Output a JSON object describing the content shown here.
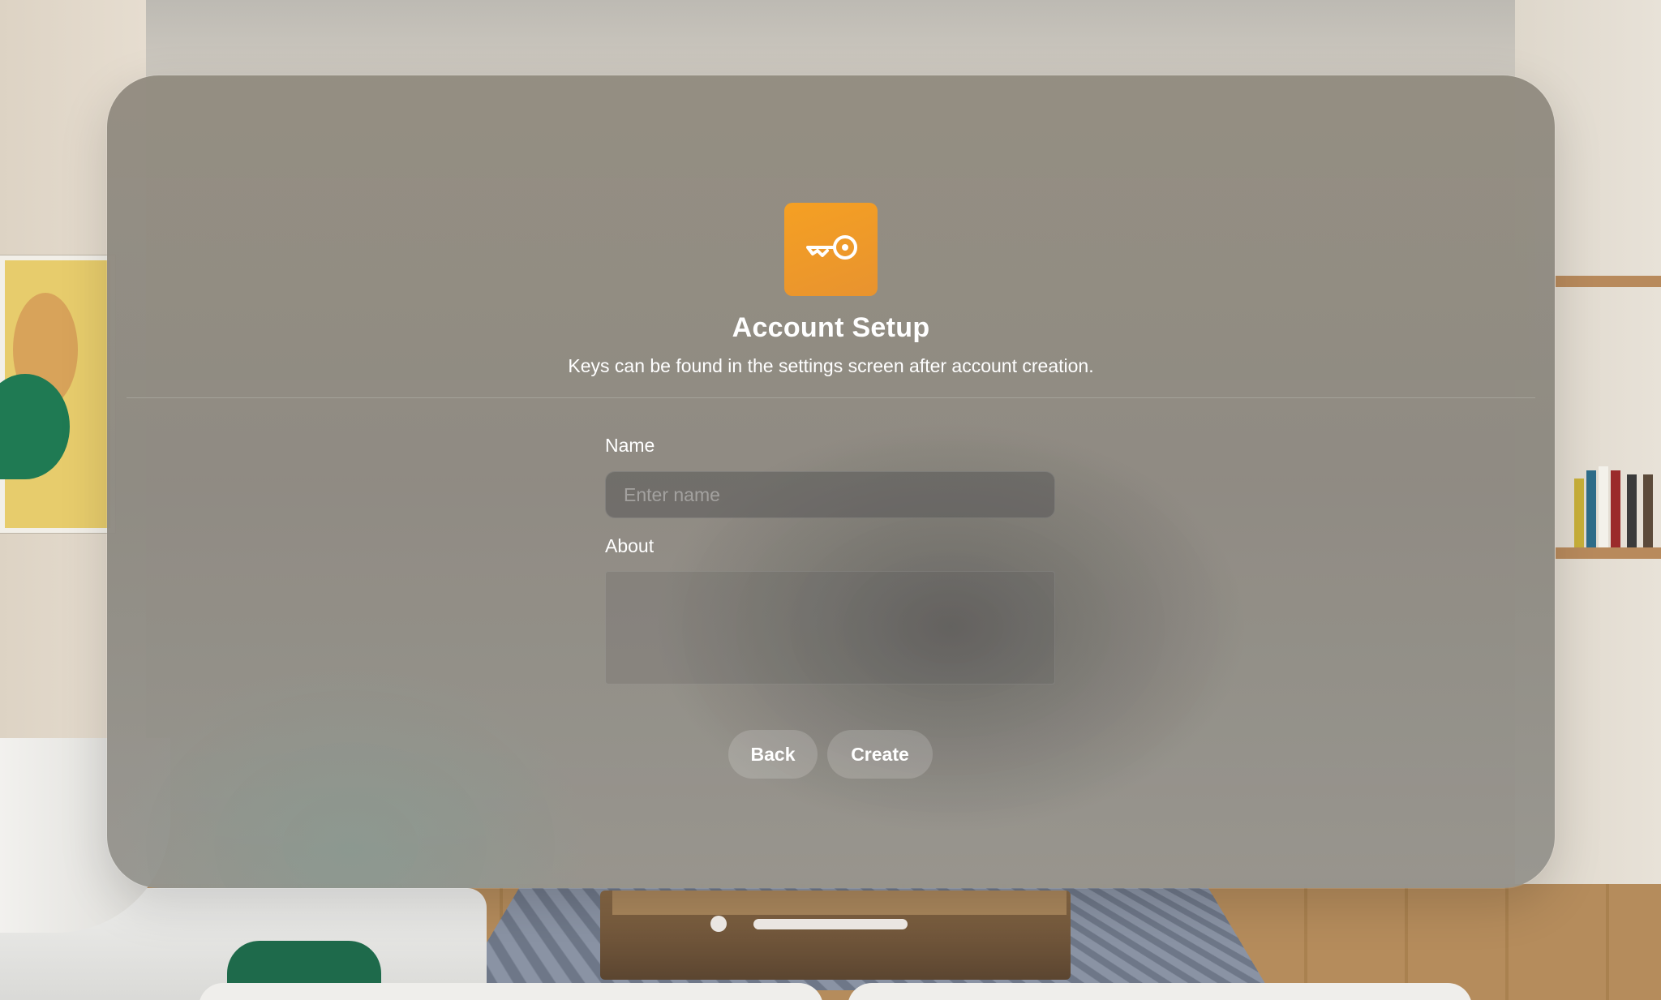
{
  "app": {
    "title": "Account Setup",
    "subtitle": "Keys can be found in the settings screen after account creation.",
    "icon": "key-icon",
    "accent_color": "#F39C22"
  },
  "form": {
    "name_label": "Name",
    "name_placeholder": "Enter name",
    "name_value": "",
    "about_label": "About",
    "about_value": ""
  },
  "actions": {
    "back_label": "Back",
    "create_label": "Create"
  }
}
